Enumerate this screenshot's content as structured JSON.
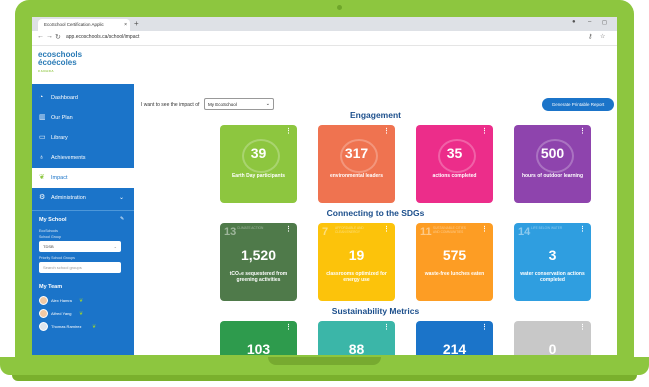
{
  "browser": {
    "tab_title": "EcoSchool Certification Applic",
    "tab_close": "×",
    "new_tab": "+",
    "url": "app.ecoschools.ca/school/impact",
    "win_min": "–",
    "win_max": "◻"
  },
  "logo": {
    "line1": "ecoschools",
    "line2": "écoécoles",
    "tagline": "CANADA"
  },
  "sidebar": {
    "items": [
      {
        "label": "Dashboard",
        "icon": "gauge-icon"
      },
      {
        "label": "Our Plan",
        "icon": "book-open-icon"
      },
      {
        "label": "Library",
        "icon": "library-icon"
      },
      {
        "label": "Achievements",
        "icon": "award-icon"
      },
      {
        "label": "Impact",
        "icon": "sprout-icon",
        "active": true
      },
      {
        "label": "Administration",
        "icon": "gear-icon"
      }
    ],
    "my_school": {
      "title": "My School",
      "school_name": "EcoSchools",
      "school_group_label": "School Group",
      "school_group_value": "TDSB",
      "priority_label": "Priority School Groups",
      "priority_placeholder": "Search school groups"
    },
    "my_team": {
      "title": "My Team",
      "members": [
        "Alex Hamra",
        "Alfred Yang",
        "Thomas Ramirez"
      ]
    }
  },
  "main": {
    "see_label": "I want to see the impact of",
    "school_select": "My EcoSchool",
    "report_button": "Generate Printable Report",
    "sections": {
      "engagement": "Engagement",
      "sdgs": "Connecting to the SDGs",
      "sustainability": "Sustainability Metrics"
    },
    "engagement_cards": [
      {
        "value": "39",
        "desc": "Earth Day participants",
        "color": "#8dc63f"
      },
      {
        "value": "317",
        "desc": "environmental leaders",
        "color": "#ef7350"
      },
      {
        "value": "35",
        "desc": "actions completed",
        "color": "#ec2d8a"
      },
      {
        "value": "500",
        "desc": "hours of outdoor learning",
        "color": "#8e44ad"
      }
    ],
    "sdg_cards": [
      {
        "num": "13",
        "sdg": "CLIMATE ACTION",
        "value": "1,520",
        "desc": "tCO₂e sequestered from greening activities",
        "color": "#4f7a4a"
      },
      {
        "num": "7",
        "sdg": "AFFORDABLE AND CLEAN ENERGY",
        "value": "19",
        "desc": "classrooms optimized for energy use",
        "color": "#fcc30b"
      },
      {
        "num": "11",
        "sdg": "SUSTAINABLE CITIES AND COMMUNITIES",
        "value": "575",
        "desc": "waste-free lunches eaten",
        "color": "#fd9d24"
      },
      {
        "num": "14",
        "sdg": "LIFE BELOW WATER",
        "value": "3",
        "desc": "water conservation actions completed",
        "color": "#2f9ee0"
      }
    ],
    "metric_cards": [
      {
        "value": "103",
        "color": "#2e9b4d"
      },
      {
        "value": "88",
        "color": "#3bb6a8"
      },
      {
        "value": "214",
        "color": "#1b74c9"
      },
      {
        "value": "0",
        "color": "#c8c8c8"
      }
    ],
    "dots": "⋮"
  }
}
